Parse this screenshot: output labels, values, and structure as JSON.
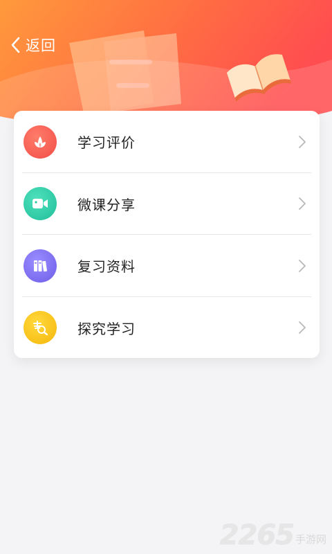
{
  "header": {
    "back_label": "返回",
    "gradient_start": "#ff8c3a",
    "gradient_end": "#ff4f4f"
  },
  "menu": {
    "items": [
      {
        "label": "学习评价",
        "icon": "flower-icon",
        "color": "#f05a4f"
      },
      {
        "label": "微课分享",
        "icon": "video-camera-icon",
        "color": "#29c9a6"
      },
      {
        "label": "复习资料",
        "icon": "books-icon",
        "color": "#7b6cf0"
      },
      {
        "label": "探究学习",
        "icon": "magnifier-icon",
        "color": "#f7c21a"
      }
    ]
  },
  "watermark": {
    "number": "2265",
    "text": "手游网"
  }
}
